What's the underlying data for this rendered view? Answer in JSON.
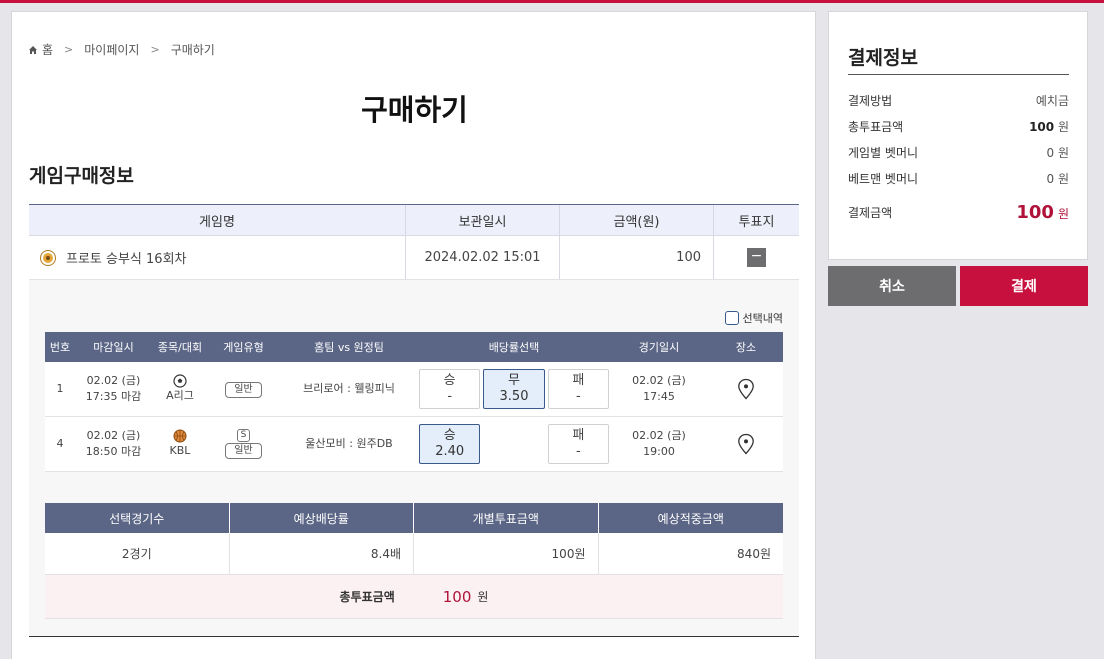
{
  "breadcrumb": {
    "home": "홈",
    "mypage": "마이페이지",
    "current": "구매하기"
  },
  "page_title": "구매하기",
  "section_title": "게임구매정보",
  "game_table": {
    "headers": [
      "게임명",
      "보관일시",
      "금액(원)",
      "투표지"
    ],
    "row": {
      "name": "프로토 승부식 16회차",
      "saved_at": "2024.02.02 15:01",
      "amount": "100",
      "toggle": "−"
    }
  },
  "select_history_label": "선택내역",
  "match_table": {
    "headers": [
      "번호",
      "마감일시",
      "종목/대회",
      "게임유형",
      "홈팀 vs 원정팀",
      "배당률선택",
      "경기일시",
      "장소"
    ],
    "rows": [
      {
        "no": "1",
        "deadline_date": "02.02 (금)",
        "deadline_time": "17:35 마감",
        "league": "A리그",
        "type_badge": "",
        "type": "일반",
        "teams": "브리로어 : 웰링피닉",
        "odds": [
          {
            "label": "승",
            "value": "-",
            "selected": false
          },
          {
            "label": "무",
            "value": "3.50",
            "selected": true
          },
          {
            "label": "패",
            "value": "-",
            "selected": false
          }
        ],
        "match_date": "02.02 (금)",
        "match_time": "17:45"
      },
      {
        "no": "4",
        "deadline_date": "02.02 (금)",
        "deadline_time": "18:50 마감",
        "league": "KBL",
        "type_badge": "S",
        "type": "일반",
        "teams": "울산모비 : 원주DB",
        "odds": [
          {
            "label": "승",
            "value": "2.40",
            "selected": true
          },
          {
            "label": "",
            "value": "",
            "selected": false
          },
          {
            "label": "패",
            "value": "-",
            "selected": false
          }
        ],
        "match_date": "02.02 (금)",
        "match_time": "19:00"
      }
    ]
  },
  "summary_table": {
    "headers": [
      "선택경기수",
      "예상배당률",
      "개별투표금액",
      "예상적중금액"
    ],
    "values": [
      "2경기",
      "8.4배",
      "100원",
      "840원"
    ],
    "total_label": "총투표금액",
    "total_value": "100",
    "total_unit": "원"
  },
  "payment": {
    "title": "결제정보",
    "rows": [
      {
        "label": "결제방법",
        "value": "예치금",
        "unit": ""
      },
      {
        "label": "총투표금액",
        "value": "100",
        "unit": "원"
      },
      {
        "label": "게임별 벳머니",
        "value": "0",
        "unit": "원"
      },
      {
        "label": "베트맨 벳머니",
        "value": "0",
        "unit": "원"
      }
    ],
    "total_label": "결제금액",
    "total_value": "100",
    "total_unit": "원"
  },
  "buttons": {
    "cancel": "취소",
    "pay": "결제"
  },
  "colors": {
    "accent": "#c8103e",
    "header_navy": "#5b6585",
    "selected_bg": "#e3eefa"
  },
  "icons": {
    "home": "home-icon",
    "soccer": "soccer-ball-icon",
    "basketball": "basketball-icon",
    "location": "location-pin-icon",
    "target": "target-icon"
  }
}
